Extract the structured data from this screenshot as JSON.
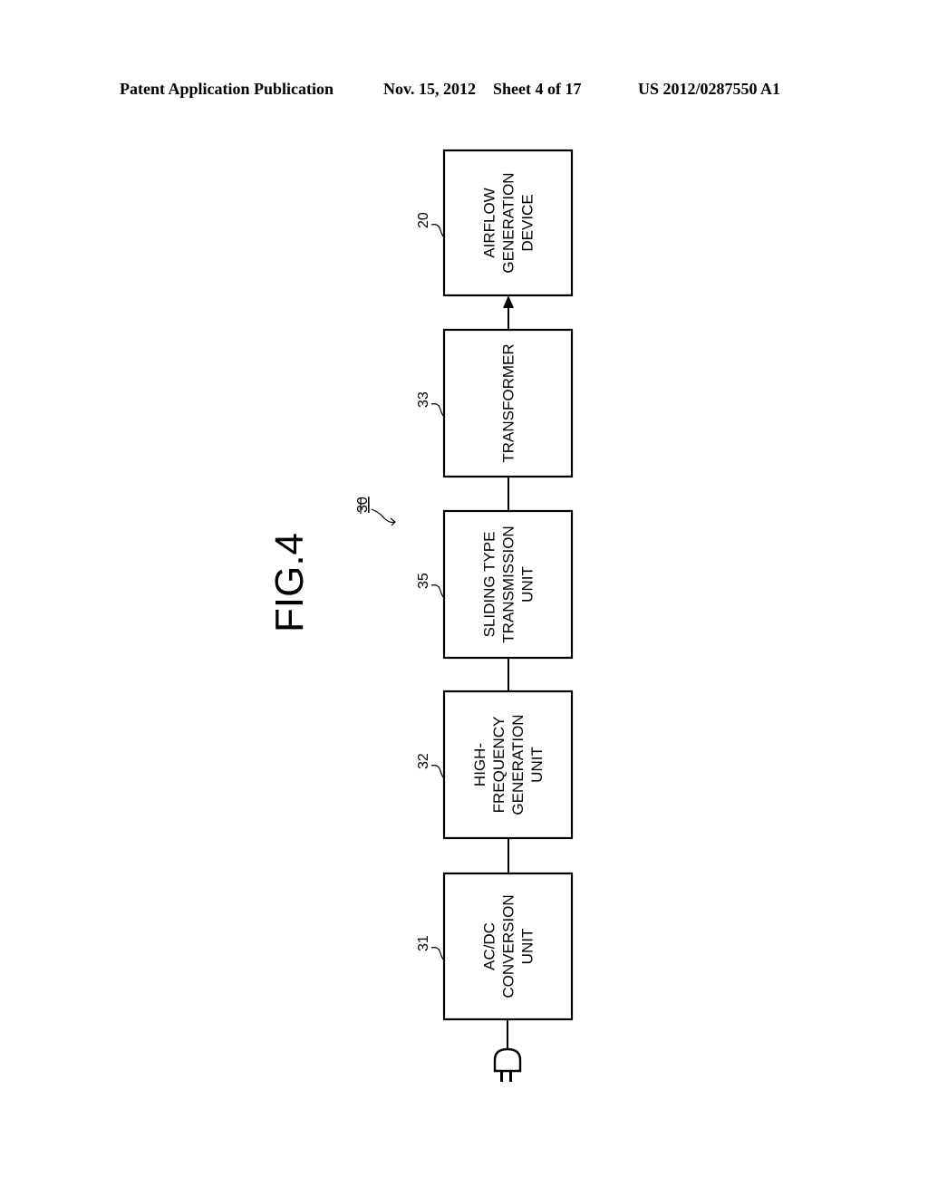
{
  "header": {
    "publication": "Patent Application Publication",
    "date": "Nov. 15, 2012",
    "sheet": "Sheet 4 of 17",
    "number": "US 2012/0287550 A1"
  },
  "figure": {
    "title": "FIG.4",
    "system_ref": "30",
    "blocks": [
      {
        "ref": "20",
        "lines": [
          "AIRFLOW",
          "GENERATION",
          "DEVICE"
        ]
      },
      {
        "ref": "33",
        "lines": [
          "TRANSFORMER"
        ]
      },
      {
        "ref": "35",
        "lines": [
          "SLIDING TYPE",
          "TRANSMISSION",
          "UNIT"
        ]
      },
      {
        "ref": "32",
        "lines": [
          "HIGH-",
          "FREQUENCY",
          "GENERATION",
          "UNIT"
        ]
      },
      {
        "ref": "31",
        "lines": [
          "AC/DC",
          "CONVERSION",
          "UNIT"
        ]
      }
    ],
    "input_icon": "power-plug-icon",
    "output_arrow": "arrow-up-icon"
  }
}
